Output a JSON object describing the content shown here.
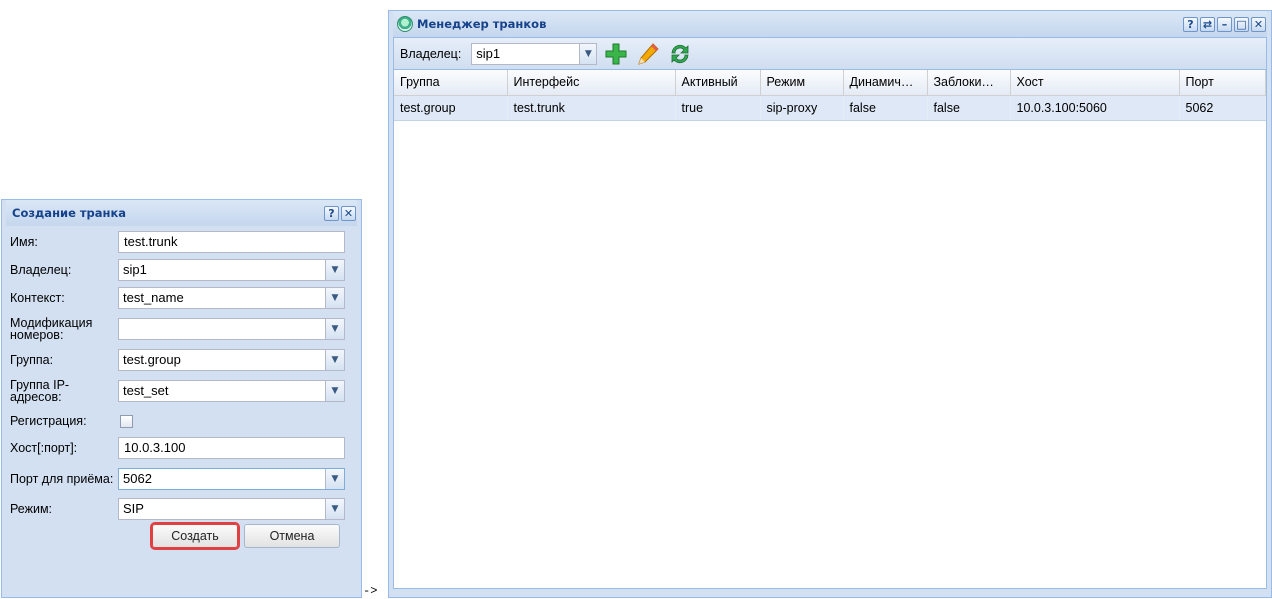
{
  "manager": {
    "title": "Менеджер транков",
    "owner_label": "Владелец:",
    "owner_value": "sip1",
    "tool_help": "?",
    "tool_refresh": "⇄",
    "tool_minimize": "–",
    "tool_maximize": "□",
    "tool_close": "✕",
    "columns": [
      "Группа",
      "Интерфейс",
      "Активный",
      "Режим",
      "Динамич…",
      "Заблоки…",
      "Хост",
      "Порт"
    ],
    "rows": [
      [
        "test.group",
        "test.trunk",
        "true",
        "sip-proxy",
        "false",
        "false",
        "10.0.3.100:5060",
        "5062"
      ]
    ]
  },
  "dialog": {
    "title": "Создание транка",
    "tool_help": "?",
    "tool_close": "✕",
    "fields": {
      "name_label": "Имя:",
      "name_value": "test.trunk",
      "owner_label": "Владелец:",
      "owner_value": "sip1",
      "context_label": "Контекст:",
      "context_value": "test_name",
      "modification_label": "Модификация номеров:",
      "modification_value": "",
      "group_label": "Группа:",
      "group_value": "test.group",
      "ipgroup_label": "Группа IP-адресов:",
      "ipgroup_value": "test_set",
      "registration_label": "Регистрация:",
      "registration_checked": false,
      "host_label": "Хост[:порт]:",
      "host_value": "10.0.3.100",
      "port_label": "Порт для приёма:",
      "port_value": "5062",
      "mode_label": "Режим:",
      "mode_value": "SIP"
    },
    "create_label": "Создать",
    "cancel_label": "Отмена"
  },
  "arrow_text": "->"
}
